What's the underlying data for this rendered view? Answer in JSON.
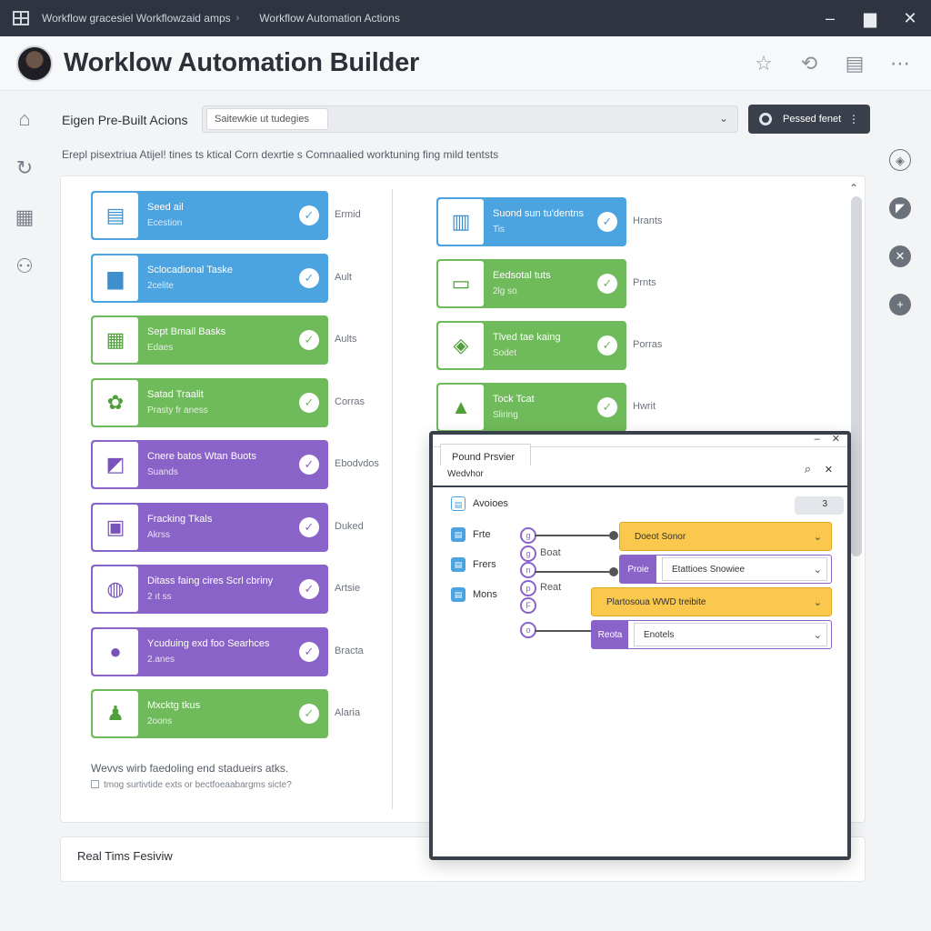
{
  "window": {
    "tab1": "Workflow gracesiel Workflowzaid amps",
    "tab2": "Workflow Automation Actions"
  },
  "header": {
    "title": "Worklow Automation Builder"
  },
  "toolbar": {
    "section_label": "Eigen Pre-Built Acions",
    "search_placeholder": "Saitewkie ut tudegies",
    "primary_button": "Pessed fenet",
    "description": "Erepl pisextriua Atijel! tines ts ktical Corn dexrtie s Comnaalied worktuning fing mild tentsts"
  },
  "left_cards": [
    {
      "title": "Seed ail",
      "sub": "Ecestion",
      "side": "Ermid",
      "color": "blue",
      "icon": "document-icon",
      "glyph": "▤"
    },
    {
      "title": "Sclocadional Taske",
      "sub": "2celite",
      "side": "Ault",
      "color": "blue",
      "icon": "folder-icon",
      "glyph": "▆"
    },
    {
      "title": "Sept Bmail Basks",
      "sub": "Edaes",
      "side": "Aults",
      "color": "green",
      "icon": "clipboard-icon",
      "glyph": "▦"
    },
    {
      "title": "Satad Traalit",
      "sub": "Prasty fr aness",
      "side": "Corras",
      "color": "green",
      "icon": "gear-icon",
      "glyph": "✿"
    },
    {
      "title": "Cnere batos Wtan Buots",
      "sub": "Suands",
      "side": "Ebodvdos",
      "color": "purple",
      "icon": "bag-icon",
      "glyph": "◩"
    },
    {
      "title": "Fracking Tkals",
      "sub": "Akrss",
      "side": "Duked",
      "color": "purple",
      "icon": "files-icon",
      "glyph": "▣"
    },
    {
      "title": "Ditass faing cires Scrl cbriny",
      "sub": "2 ıt ss",
      "side": "Artsie",
      "color": "purple",
      "icon": "user-icon",
      "glyph": "◍"
    },
    {
      "title": "Ycuduing exd foo Searhces",
      "sub": "2.anes",
      "side": "Bracta",
      "color": "purple",
      "icon": "person-icon",
      "glyph": "●"
    },
    {
      "title": "Mxcktg tkus",
      "sub": "2oons",
      "side": "Alaria",
      "color": "green",
      "icon": "figure-icon",
      "glyph": "♟"
    }
  ],
  "right_cards": [
    {
      "title": "Suond sun tu'dentns",
      "sub": "Tis",
      "side": "Hrants",
      "color": "blue",
      "icon": "document-icon",
      "glyph": "▥"
    },
    {
      "title": "Eedsotal tuts",
      "sub": "2lg so",
      "side": "Prnts",
      "color": "green",
      "icon": "laptop-icon",
      "glyph": "▭"
    },
    {
      "title": "Tlved tae kaing",
      "sub": "Sodet",
      "side": "Porras",
      "color": "green",
      "icon": "image-icon",
      "glyph": "◈"
    },
    {
      "title": "Tock Tcat",
      "sub": "Sliring",
      "side": "Hwrit",
      "color": "green",
      "icon": "chart-icon",
      "glyph": "▲"
    }
  ],
  "footer": {
    "note": "Wevvs wirb faedoling end stadueirs atks.",
    "note2": "tmog surtivtide exts or bectfoeaabargms sicte?",
    "realtime_label": "Real Tims Fesiviw"
  },
  "overlay": {
    "tab": "Pound Prsvier",
    "subtitle": "Wedvhor",
    "pill": "3",
    "list": [
      {
        "label": "Avoioes",
        "style": "light",
        "glyph": "▤"
      },
      {
        "label": "Frte",
        "style": "solid",
        "glyph": "▤"
      },
      {
        "label": "Frers",
        "style": "solid",
        "glyph": "▤"
      },
      {
        "label": "Mons",
        "style": "solid",
        "glyph": "▤"
      }
    ],
    "nodes": [
      {
        "glyph": "g"
      },
      {
        "glyph": "g",
        "label": "Boat"
      },
      {
        "glyph": "n"
      },
      {
        "glyph": "p",
        "label": "Reat"
      },
      {
        "glyph": "F"
      },
      {
        "glyph": "o"
      }
    ],
    "steps": [
      {
        "type": "yellow",
        "text": "Doeot Sonor"
      },
      {
        "type": "split",
        "tag": "Proie",
        "field": "Etattioes Snowiee"
      },
      {
        "type": "yellow",
        "text": "Plartosoua WWD treibite"
      },
      {
        "type": "split",
        "tag": "Reota",
        "field": "Enotels"
      }
    ]
  }
}
